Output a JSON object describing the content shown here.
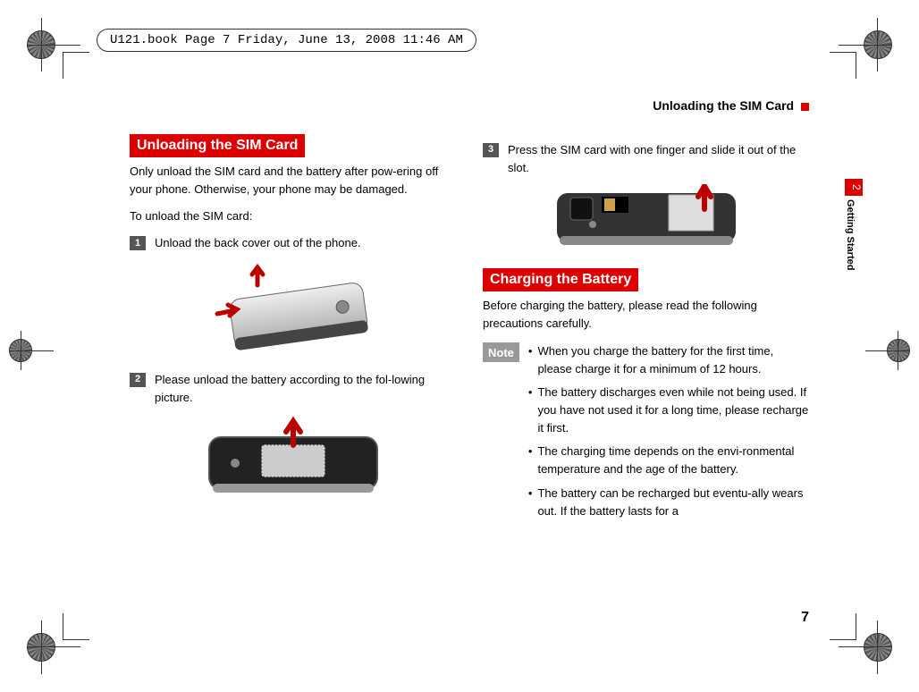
{
  "meta_header": "U121.book  Page 7  Friday, June 13, 2008  11:46 AM",
  "running_head": "Unloading the SIM Card",
  "side": {
    "chapter_num": "2",
    "chapter_title": "Getting Started"
  },
  "page_number": "7",
  "left": {
    "heading": "Unloading the SIM Card",
    "intro": "Only unload the SIM card and the battery after pow-ering off your phone. Otherwise, your phone may be damaged.",
    "intro2": "To unload the SIM card:",
    "step1_num": "1",
    "step1_text": "Unload the back cover out of  the phone.",
    "step2_num": "2",
    "step2_text": "Please unload the battery according to the fol-lowing picture."
  },
  "right": {
    "step3_num": "3",
    "step3_text": "Press the SIM card with one finger and slide it out of the slot.",
    "heading": "Charging the Battery",
    "intro": "Before charging the battery, please read the following precautions carefully.",
    "note_label": "Note",
    "notes": {
      "n1": "When you charge the battery for the first time, please charge it for a minimum of 12 hours.",
      "n2": "The battery discharges even while not being used. If you have not used it for a long time, please recharge it first.",
      "n3": "The charging time depends on the envi-ronmental temperature and the age of the battery.",
      "n4": "The battery can be recharged but eventu-ally wears out. If the battery lasts for a"
    }
  }
}
